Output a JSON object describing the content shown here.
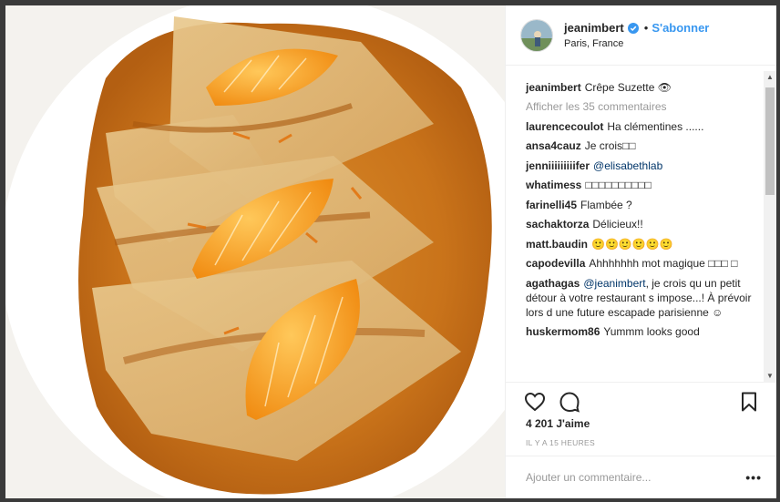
{
  "post": {
    "username": "jeanimbert",
    "follow_label": "S'abonner",
    "separator": "•",
    "location": "Paris, France",
    "image_alt": "Crêpe Suzette with orange slices and caramel sauce on a white plate"
  },
  "caption": {
    "username": "jeanimbert",
    "text": "Crêpe Suzette 👁"
  },
  "view_comments_label": "Afficher les 35 commentaires",
  "comments": [
    {
      "username": "laurencecoulot",
      "text": "Ha clémentines ......"
    },
    {
      "username": "ansa4cauz",
      "text": "Je crois□□"
    },
    {
      "username": "jenniiiiiiiiifer",
      "mention": "@elisabethlab",
      "text": ""
    },
    {
      "username": "whatimess",
      "text": "□□□□□□□□□□"
    },
    {
      "username": "farinelli45",
      "text": "Flambée ?"
    },
    {
      "username": "sachaktorza",
      "text": "Délicieux!!"
    },
    {
      "username": "matt.baudin",
      "text": "🙂🙂🙂🙂🙂🙂"
    },
    {
      "username": "capodevilla",
      "text": "Ahhhhhhh mot magique □□□ □"
    },
    {
      "username": "agathagas",
      "mention": "@jeanimbert",
      "text": ", je crois qu un petit détour à votre restaurant s impose...! À prévoir lors d une future escapade parisienne ☺"
    },
    {
      "username": "huskermom86",
      "text": "Yummm looks good"
    }
  ],
  "likes_label": "4 201 J'aime",
  "timestamp": "IL Y A 15 HEURES",
  "add_comment_placeholder": "Ajouter un commentaire...",
  "options_label": "•••",
  "icons": {
    "like": "heart-icon",
    "comment": "comment-icon",
    "save": "bookmark-icon",
    "verified": "verified-badge-icon"
  },
  "colors": {
    "link": "#3897f0",
    "muted": "#999999",
    "text": "#262626"
  }
}
